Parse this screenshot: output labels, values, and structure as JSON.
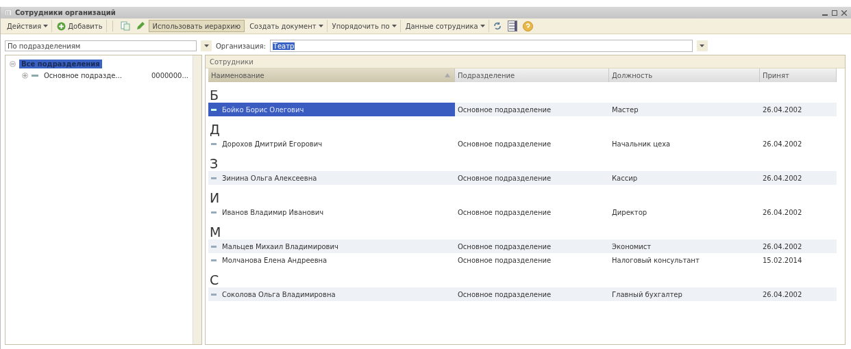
{
  "window": {
    "title": "Сотрудники организаций"
  },
  "toolbar": [
    {
      "kind": "menu",
      "label": "Действия"
    },
    {
      "kind": "icon-text",
      "label": "Добавить"
    },
    {
      "kind": "separator"
    },
    {
      "kind": "copy"
    },
    {
      "kind": "edit"
    },
    {
      "kind": "toggle",
      "label": "Использовать иерархию",
      "on": true
    },
    {
      "kind": "menu",
      "label": "Создать документ"
    },
    {
      "kind": "menu",
      "label": "Упорядочить по"
    },
    {
      "kind": "menu",
      "label": "Данные сотрудника"
    },
    {
      "kind": "refresh"
    },
    {
      "kind": "list"
    },
    {
      "kind": "help"
    }
  ],
  "filter": {
    "mode": "По подразделениям",
    "organization_label": "Организация:",
    "organization": "Театр"
  },
  "tree": {
    "items": [
      {
        "label": "Все подразделения",
        "selected": true,
        "expanded": true,
        "children": [
          {
            "label": "Основное подразде...",
            "code": "0000000...",
            "selected": false,
            "expanded": false
          }
        ]
      }
    ]
  },
  "table": {
    "title": "Сотрудники",
    "columns": [
      "Наименование",
      "Подразделение",
      "Должность",
      "Принят"
    ],
    "groups": [
      {
        "letter": "Б",
        "rows": [
          {
            "name": "Бойко Борис Олегович",
            "department": "Основное подразделение",
            "position": "Мастер",
            "hired": "26.04.2002",
            "selected": true
          }
        ]
      },
      {
        "letter": "Д",
        "rows": [
          {
            "name": "Дорохов Дмитрий Егорович",
            "department": "Основное подразделение",
            "position": "Начальник цеха",
            "hired": "26.04.2002",
            "selected": false
          }
        ]
      },
      {
        "letter": "З",
        "rows": [
          {
            "name": "Зинина Ольга Алексеевна",
            "department": "Основное подразделение",
            "position": "Кассир",
            "hired": "26.04.2002",
            "selected": false
          }
        ]
      },
      {
        "letter": "И",
        "rows": [
          {
            "name": "Иванов Владимир Иванович",
            "department": "Основное подразделение",
            "position": "Директор",
            "hired": "26.04.2002",
            "selected": false
          }
        ]
      },
      {
        "letter": "М",
        "rows": [
          {
            "name": "Мальцев Михаил Владимирович",
            "department": "Основное подразделение",
            "position": "Экономист",
            "hired": "26.04.2002",
            "selected": false
          },
          {
            "name": "Молчанова Елена Андреевна",
            "department": "Основное подразделение",
            "position": "Налоговый консультант",
            "hired": "15.02.2014",
            "selected": false
          }
        ]
      },
      {
        "letter": "С",
        "rows": [
          {
            "name": "Соколова Ольга Владимировна",
            "department": "Основное подразделение",
            "position": "Главный бухгалтер",
            "hired": "26.04.2002",
            "selected": false
          }
        ]
      }
    ]
  }
}
